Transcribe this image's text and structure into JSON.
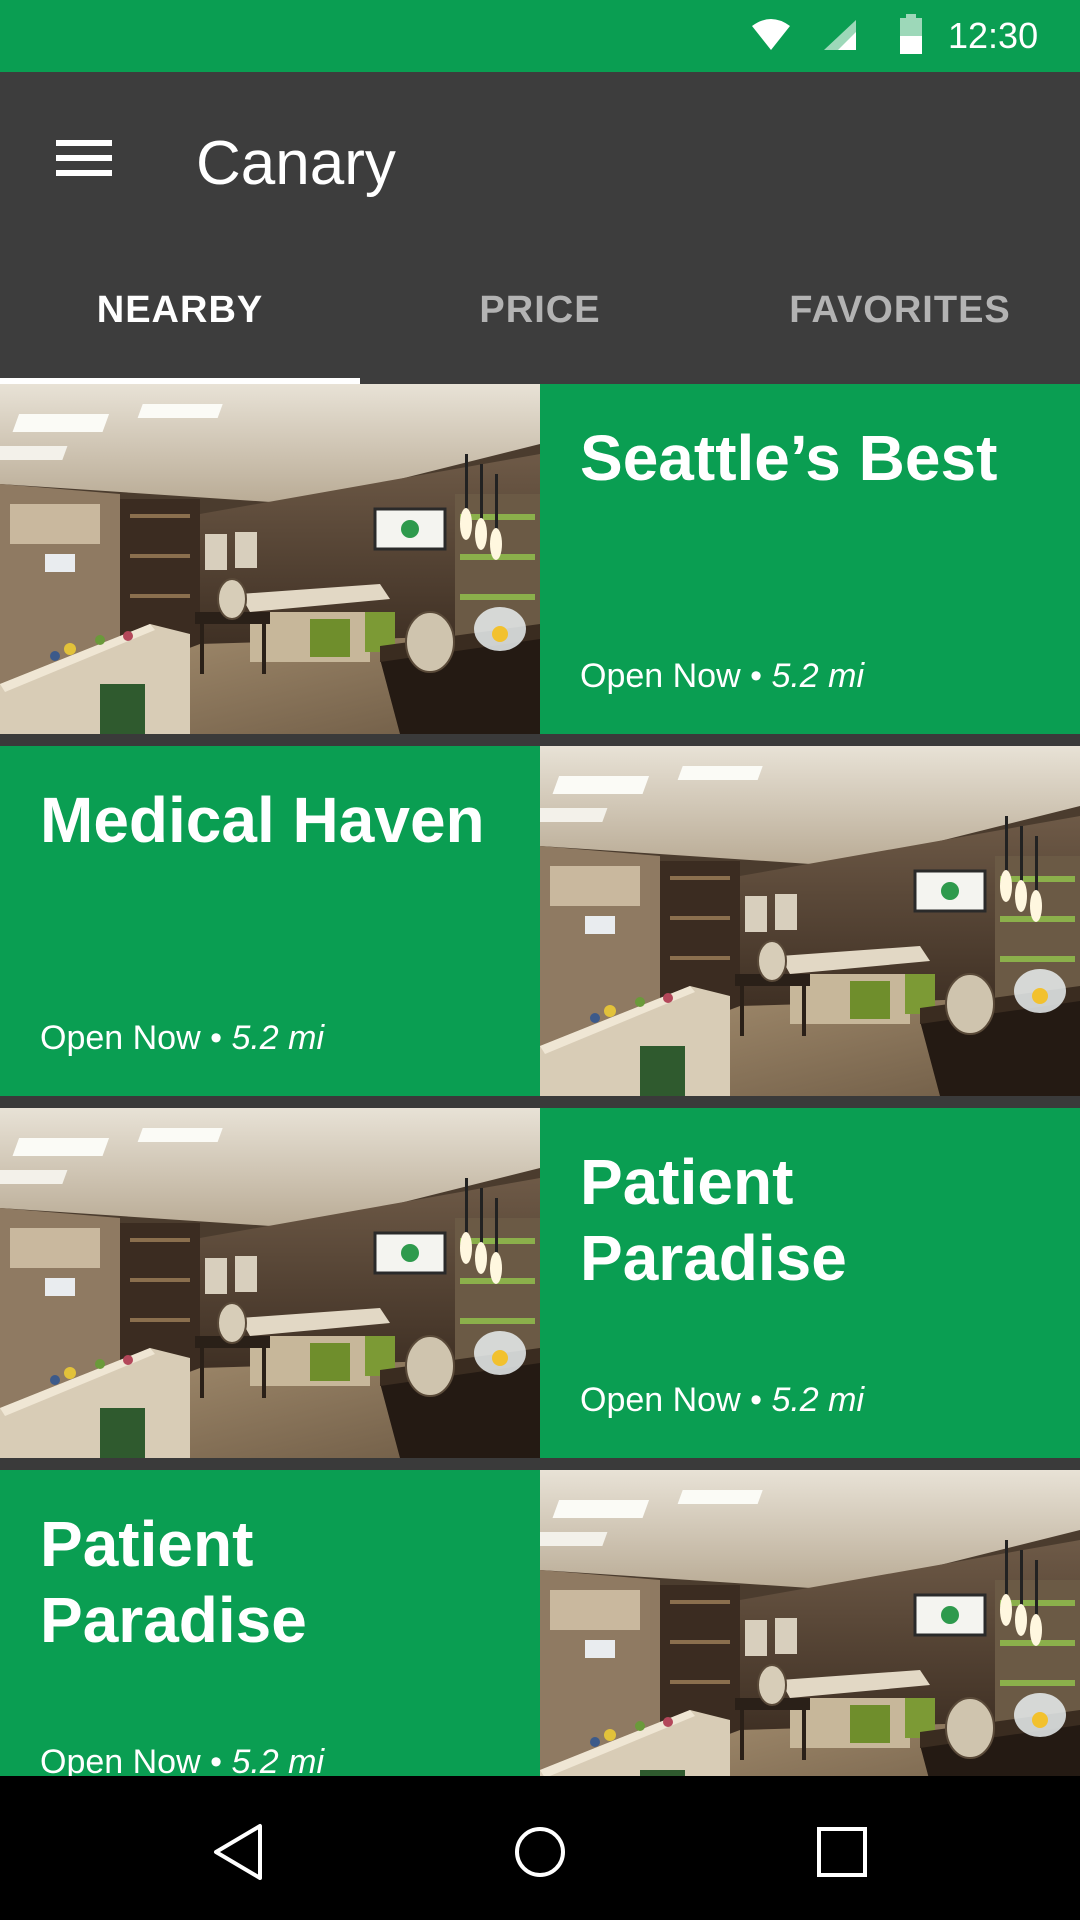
{
  "status_bar": {
    "time": "12:30",
    "icons": [
      "wifi-icon",
      "cell-signal-icon",
      "battery-icon"
    ]
  },
  "app_bar": {
    "menu_icon": "hamburger-menu-icon",
    "title": "Canary",
    "tabs": [
      {
        "label": "NEARBY",
        "active": true
      },
      {
        "label": "PRICE",
        "active": false
      },
      {
        "label": "FAVORITES",
        "active": false
      }
    ]
  },
  "dispensaries": [
    {
      "name": "Seattle’s Best",
      "status": "Open Now",
      "separator": "•",
      "distance": "5.2 mi"
    },
    {
      "name": "Medical Haven",
      "status": "Open Now",
      "separator": "•",
      "distance": "5.2 mi"
    },
    {
      "name": "Patient Paradise",
      "status": "Open Now",
      "separator": "•",
      "distance": "5.2 mi"
    },
    {
      "name": "Patient Paradise",
      "status": "Open Now",
      "separator": "•",
      "distance": "5.2 mi"
    }
  ],
  "nav_bar": {
    "icons": [
      "back-icon",
      "home-icon",
      "recents-icon"
    ]
  },
  "colors": {
    "brand_green": "#0a9e52",
    "app_bar": "#3d3d3d",
    "tab_inactive": "#b3b3b3",
    "nav_bar": "#000000"
  }
}
